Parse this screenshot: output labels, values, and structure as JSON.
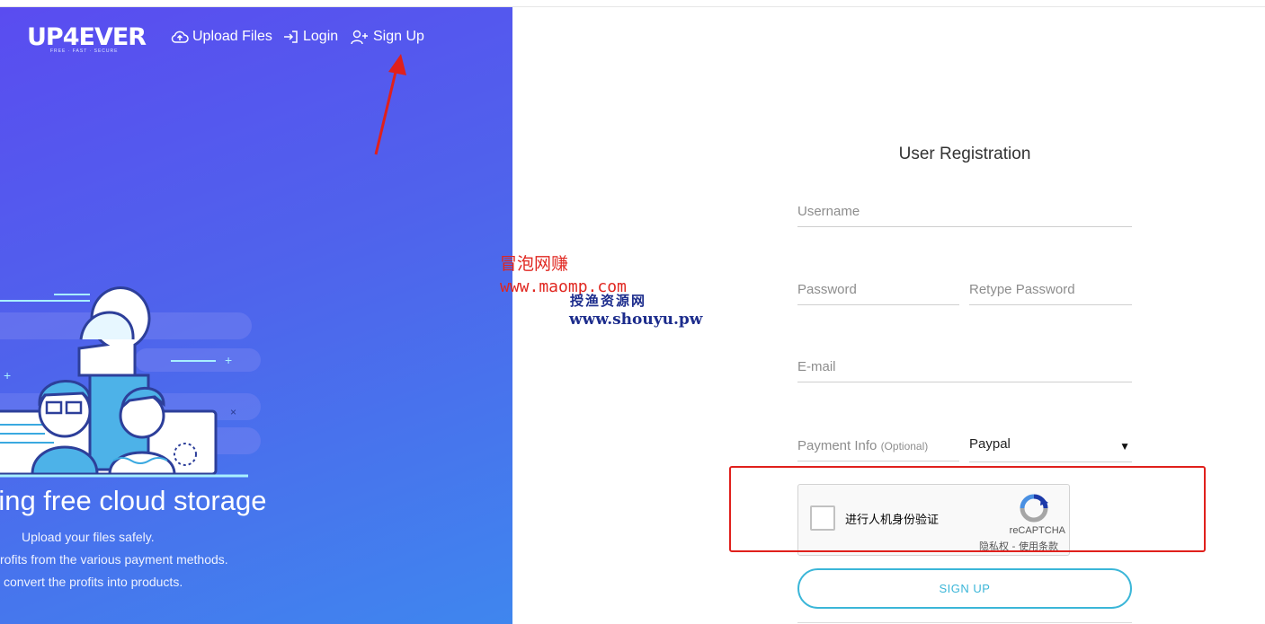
{
  "brand": {
    "logo": "UP4EVER",
    "tagline": "FREE · FAST · SECURE"
  },
  "nav": {
    "upload": {
      "label": "Upload Files",
      "icon": "cloud-upload-icon"
    },
    "login": {
      "label": "Login",
      "icon": "sign-in-icon"
    },
    "signup": {
      "label": "Sign Up",
      "icon": "user-plus-icon"
    }
  },
  "hero": {
    "title": "ring free cloud storage",
    "lines": [
      "Upload your files safely.",
      "rofits from the various payment methods.",
      "convert the profits into products."
    ]
  },
  "watermarks": {
    "red_line1": "冒泡网赚",
    "red_line2": "www.maomp.com",
    "blue_line1": "授渔资源网",
    "blue_line2": "www.shouyu.pw"
  },
  "form": {
    "title": "User Registration",
    "username_placeholder": "Username",
    "password_placeholder": "Password",
    "retype_placeholder": "Retype Password",
    "email_placeholder": "E-mail",
    "payment_label": "Payment Info",
    "payment_optional": "(Optional)",
    "payment_method": "Paypal",
    "submit_label": "SIGN UP"
  },
  "recaptcha": {
    "label": "进行人机身份验证",
    "brand": "reCAPTCHA",
    "terms": "隐私权 - 使用条款"
  },
  "colors": {
    "gradient_start": "#5a4cf0",
    "gradient_end": "#3f86ee",
    "accent": "#3bb6d8",
    "highlight": "#e0201c"
  }
}
